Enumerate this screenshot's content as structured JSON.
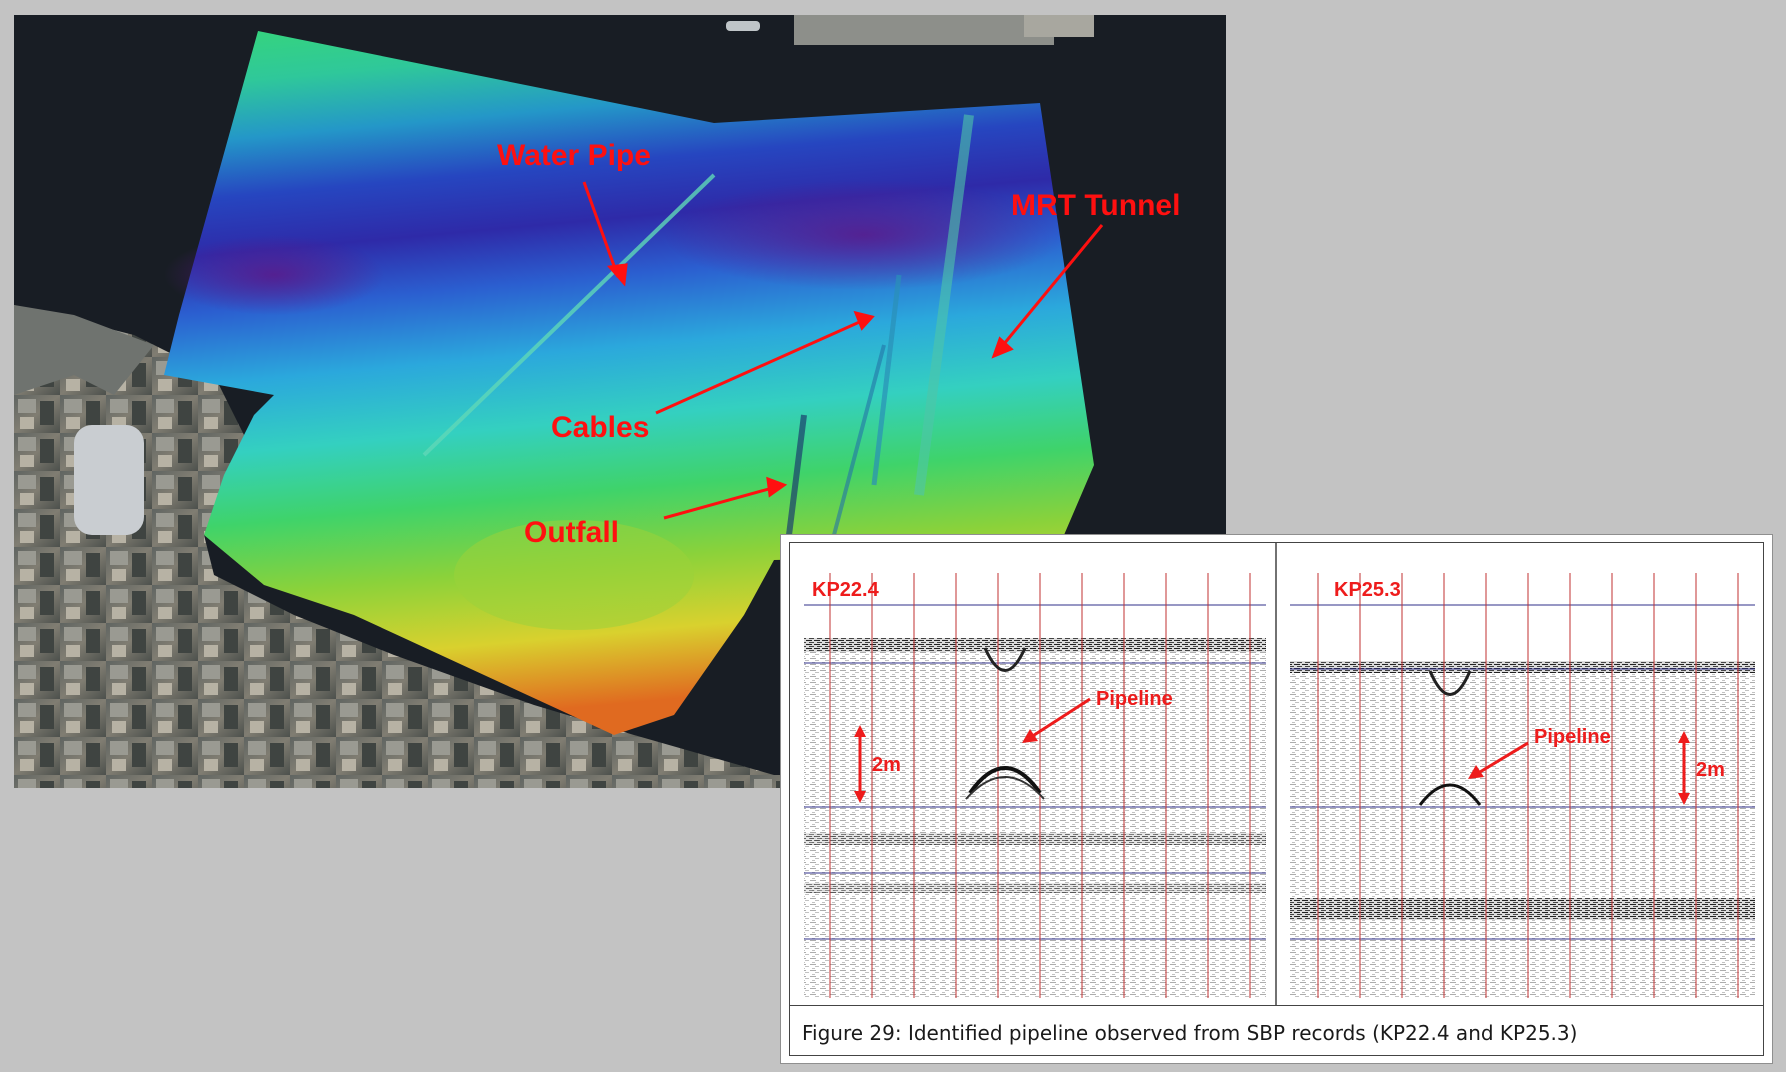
{
  "map": {
    "labels": {
      "water_pipe": "Water Pipe",
      "mrt_tunnel": "MRT Tunnel",
      "cables": "Cables",
      "outfall": "Outfall"
    },
    "annotation_color": "#ff1010"
  },
  "figure": {
    "left_profile_label": "KP22.4",
    "right_profile_label": "KP25.3",
    "pipeline_label": "Pipeline",
    "scale_label": "2m",
    "caption": "Figure 29: Identified pipeline observed from SBP records (KP22.4 and KP25.3)"
  }
}
